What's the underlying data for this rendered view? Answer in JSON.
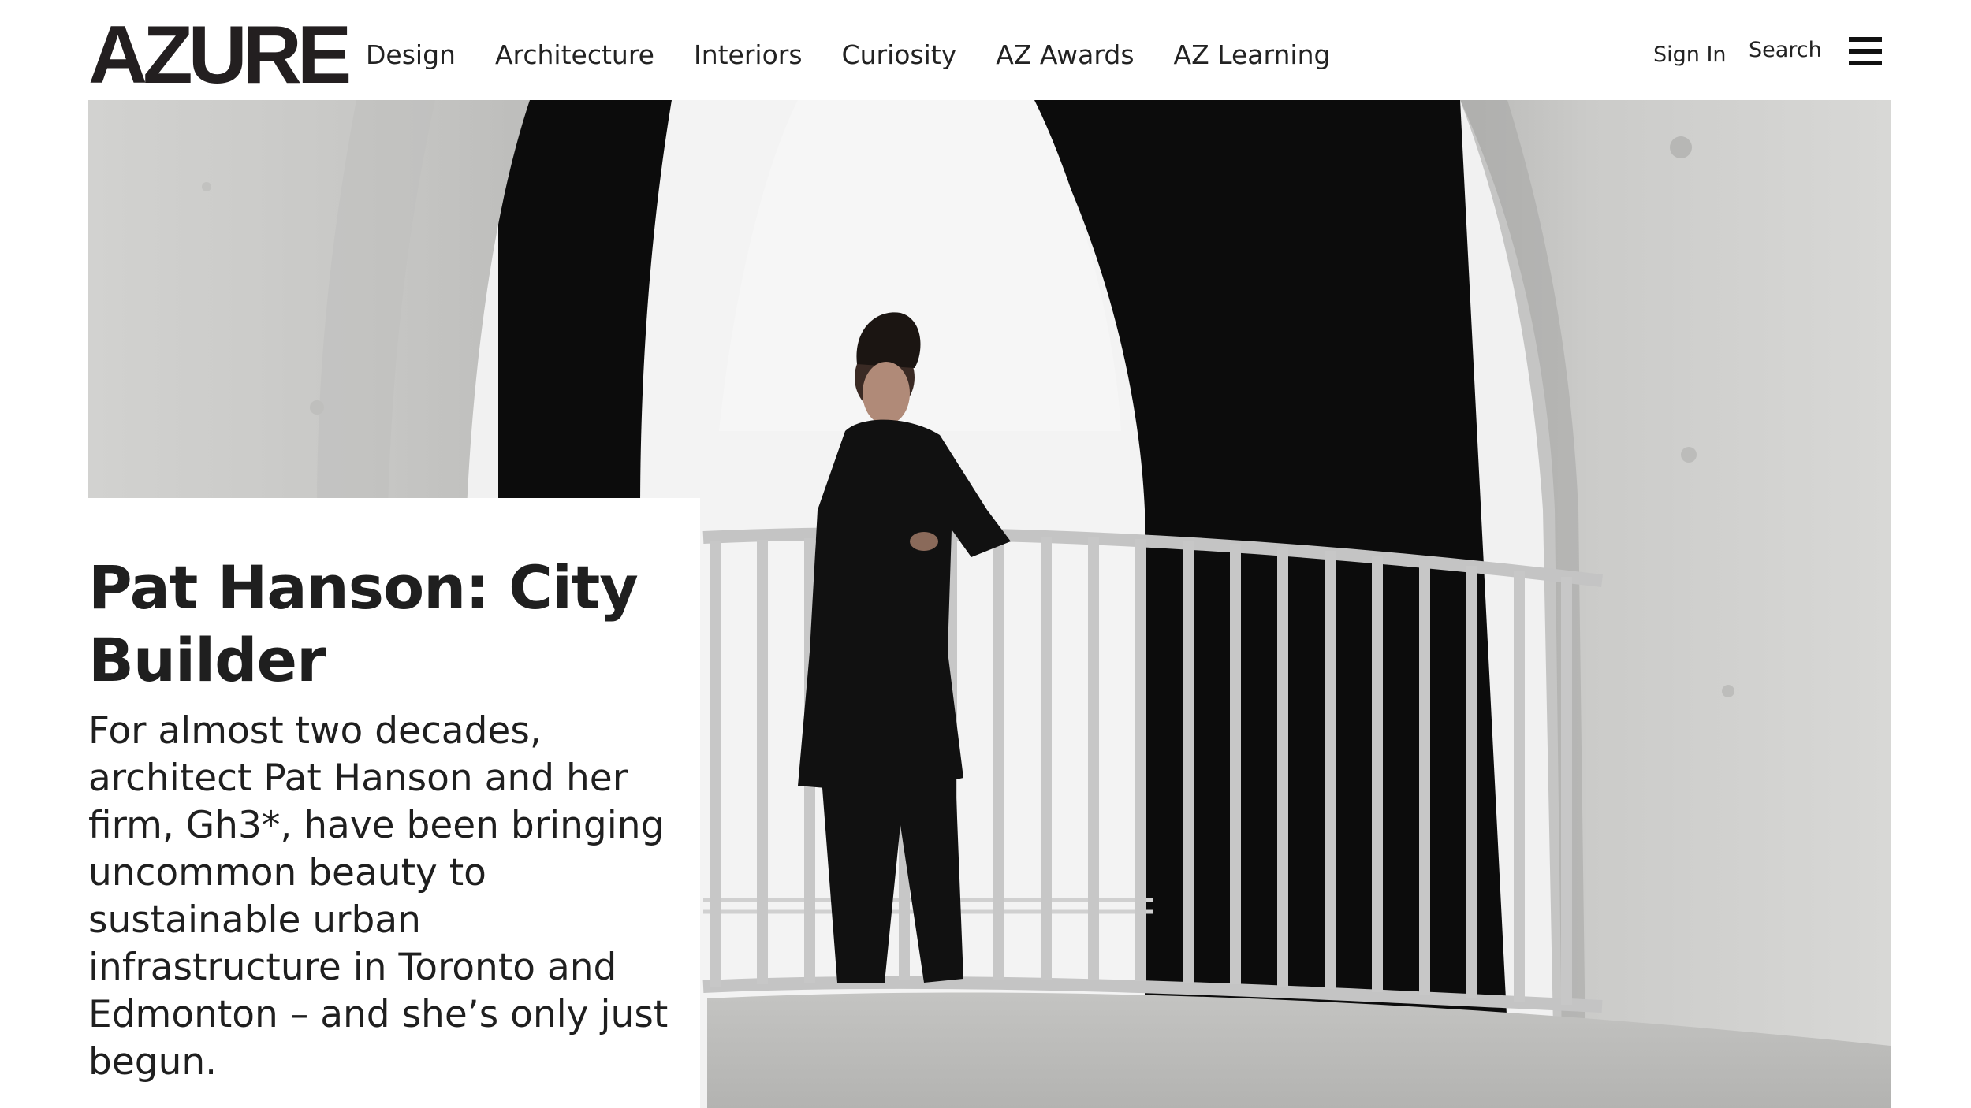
{
  "header": {
    "logo_text": "AZURE",
    "nav_items": [
      {
        "label": "Design"
      },
      {
        "label": "Architecture"
      },
      {
        "label": "Interiors"
      },
      {
        "label": "Curiosity"
      },
      {
        "label": "AZ Awards"
      },
      {
        "label": "AZ Learning"
      }
    ],
    "sign_in_label": "Sign In",
    "search_label": "Search",
    "menu_icon": "hamburger-menu-icon"
  },
  "hero": {
    "image_subject": "woman in black coat leaning on railing under concrete arch",
    "colors": {
      "concrete": "#cfcfcd",
      "arch_dark": "#0d0d0d",
      "sky": "#f2f2f2",
      "railing": "#c9c9c9"
    }
  },
  "article": {
    "headline": "Pat Hanson: City Builder",
    "dek": "For almost two decades, architect Pat Hanson and her firm, Gh3*, have been bringing uncommon beauty to sustainable urban infrastructure in Toronto and Edmonton – and she’s only just begun."
  }
}
